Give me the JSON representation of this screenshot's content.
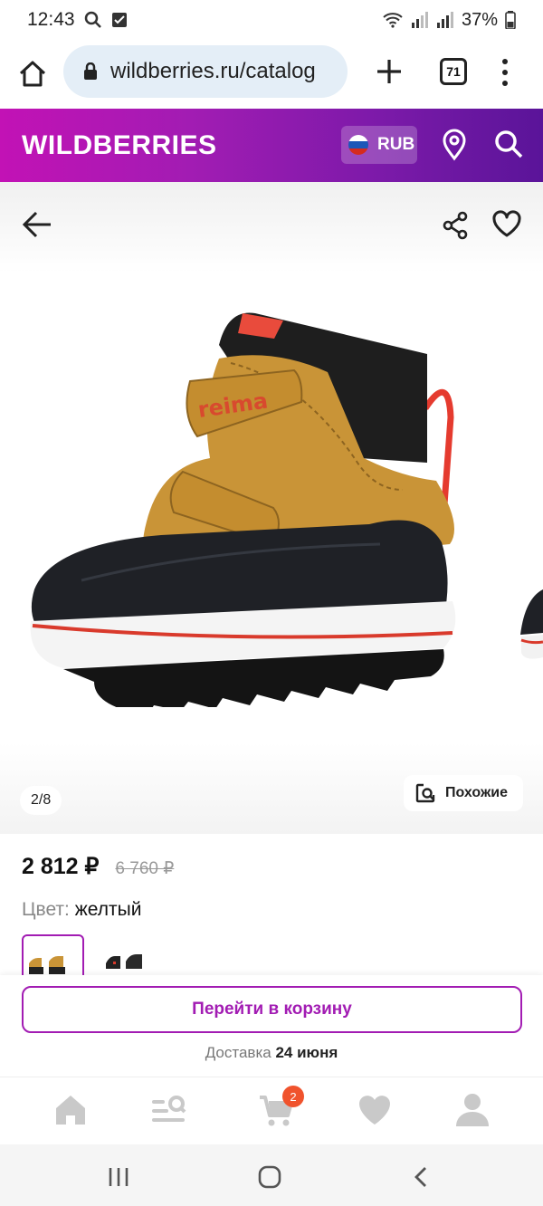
{
  "status_bar": {
    "time": "12:43",
    "battery": "37%"
  },
  "browser": {
    "url": "wildberries.ru/catalog",
    "tab_count": "71"
  },
  "header": {
    "logo": "WILDBERRIES",
    "currency": "RUB"
  },
  "gallery": {
    "counter": "2/8",
    "similar_label": "Похожие"
  },
  "product": {
    "price": "2 812 ₽",
    "old_price": "6 760 ₽",
    "color_label": "Цвет:",
    "color_value": "желтый"
  },
  "actions": {
    "cart_button": "Перейти в корзину",
    "delivery_label": "Доставка",
    "delivery_date": "24 июня"
  },
  "tabbar": {
    "items": [
      "home-icon",
      "catalog-icon",
      "cart-icon",
      "heart-icon",
      "profile-icon"
    ],
    "cart_badge": "2"
  },
  "colors": {
    "accent": "#a21cb3",
    "badge": "#f0532d"
  }
}
